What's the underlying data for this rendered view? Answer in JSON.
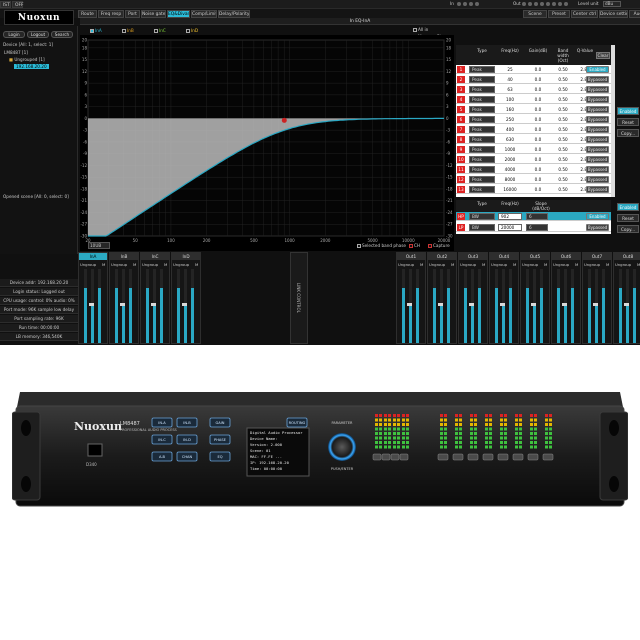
{
  "menu": [
    "IST",
    "OFF"
  ],
  "nav_tabs": [
    {
      "label": "Route",
      "active": false
    },
    {
      "label": "Freq resp",
      "active": false
    },
    {
      "label": "Port",
      "active": false
    },
    {
      "label": "Noise gate",
      "active": false
    },
    {
      "label": "EQ&Divan",
      "active": true
    },
    {
      "label": "Comp/Limit",
      "active": false
    },
    {
      "label": "Delay/Polarity",
      "active": false
    }
  ],
  "right_tabs": [
    "Scene",
    "Preset",
    "Center ctrl",
    "Device setting",
    "Audi"
  ],
  "top_right": {
    "in_label": "In",
    "out_label": "Out",
    "level_label": "Level unit",
    "level_value": "dBu"
  },
  "logo": "Nuoxun",
  "left": {
    "buttons": [
      "Login",
      "Logout",
      "Search"
    ],
    "device_label": "Device [All: 1, select: 1]",
    "tree": [
      "LM8487 [1]",
      "Ungrouped [1]",
      "192.168.20.20"
    ],
    "opened_label": "Opened scene [All: 0, select: 0]",
    "status": [
      "Device addr: 192.168.20.20",
      "Login status: Logged out",
      "CPU usage: control: 0%  audio: 0%",
      "Port mode: 96K sample low delay",
      "Port sampling rate: 96K",
      "Run time: 00:00:00",
      "LB memory: 346,540K"
    ]
  },
  "eq": {
    "header": "In EQ-InA",
    "channels": [
      "InA",
      "InB",
      "InC",
      "InD"
    ],
    "all_in": "All in",
    "mag": "Mag",
    "phase": "Phase",
    "y_ticks": [
      "20",
      "18",
      "15",
      "12",
      "9",
      "6",
      "3",
      "0",
      "-3",
      "-6",
      "-9",
      "-12",
      "-15",
      "-18",
      "-21",
      "-24",
      "-27",
      "-30"
    ],
    "x_ticks": [
      "20",
      "50",
      "100",
      "200",
      "500",
      "1000",
      "2000",
      "5000",
      "10000",
      "20000"
    ],
    "freq_unit": "10UB",
    "bottom": {
      "selected_band": "Selected band phase",
      "ch": "CH",
      "capture": "Capture"
    },
    "table_headers": [
      "Type",
      "Freq(Hz)",
      "Gain(dB)",
      "Band width (Oct)",
      "Q-Value",
      "Clear"
    ],
    "bands": [
      {
        "n": "1",
        "type": "Peak",
        "freq": "25",
        "gain": "0.0",
        "bw": "0.50",
        "q": "2.87",
        "state": "Enabled"
      },
      {
        "n": "2",
        "type": "Peak",
        "freq": "40",
        "gain": "0.0",
        "bw": "0.50",
        "q": "2.87",
        "state": "Bypassed"
      },
      {
        "n": "3",
        "type": "Peak",
        "freq": "63",
        "gain": "0.0",
        "bw": "0.50",
        "q": "2.87",
        "state": "Bypassed"
      },
      {
        "n": "4",
        "type": "Peak",
        "freq": "100",
        "gain": "0.0",
        "bw": "0.50",
        "q": "2.87",
        "state": "Bypassed"
      },
      {
        "n": "5",
        "type": "Peak",
        "freq": "160",
        "gain": "0.0",
        "bw": "0.50",
        "q": "2.87",
        "state": "Bypassed"
      },
      {
        "n": "6",
        "type": "Peak",
        "freq": "250",
        "gain": "0.0",
        "bw": "0.50",
        "q": "2.87",
        "state": "Bypassed"
      },
      {
        "n": "7",
        "type": "Peak",
        "freq": "400",
        "gain": "0.0",
        "bw": "0.50",
        "q": "2.87",
        "state": "Bypassed"
      },
      {
        "n": "8",
        "type": "Peak",
        "freq": "630",
        "gain": "0.0",
        "bw": "0.50",
        "q": "2.87",
        "state": "Bypassed"
      },
      {
        "n": "9",
        "type": "Peak",
        "freq": "1000",
        "gain": "0.0",
        "bw": "0.50",
        "q": "2.87",
        "state": "Bypassed"
      },
      {
        "n": "10",
        "type": "Peak",
        "freq": "2000",
        "gain": "0.0",
        "bw": "0.50",
        "q": "2.87",
        "state": "Bypassed"
      },
      {
        "n": "11",
        "type": "Peak",
        "freq": "4000",
        "gain": "0.0",
        "bw": "0.50",
        "q": "2.87",
        "state": "Bypassed"
      },
      {
        "n": "12",
        "type": "Peak",
        "freq": "8000",
        "gain": "0.0",
        "bw": "0.50",
        "q": "2.87",
        "state": "Bypassed"
      },
      {
        "n": "13",
        "type": "Peak",
        "freq": "16000",
        "gain": "0.0",
        "bw": "0.50",
        "q": "2.87",
        "state": "Bypassed"
      }
    ],
    "side_buttons": [
      "Enabled",
      "Reset",
      "Copy..."
    ],
    "filter_headers": [
      "Type",
      "Freq(Hz)",
      "Slope (dB/Oct)"
    ],
    "filters": [
      {
        "n": "HP",
        "type": "BW",
        "freq": "902",
        "slope": "6",
        "state": "Enabled"
      },
      {
        "n": "LP",
        "type": "BW",
        "freq": "20000",
        "slope": "6",
        "state": "Bypassed"
      }
    ],
    "filter_buttons": [
      "Enabled",
      "Reset",
      "Copy..."
    ],
    "curve": {
      "hp_freq": 902,
      "floor_db": -30,
      "flat_db": 0
    }
  },
  "strips": {
    "inputs": [
      "InA",
      "InB",
      "InC",
      "InD"
    ],
    "outputs": [
      "Out1",
      "Out2",
      "Out3",
      "Out4",
      "Out5",
      "Out6",
      "Out7",
      "Out8"
    ],
    "labels": [
      "Ungroup",
      "M"
    ],
    "center_text": "LINK  CONTROL"
  },
  "device": {
    "brand": "Nuoxun",
    "model": "LM8487",
    "model_sub": "PROFESSIONAL AUDIO PROCESS",
    "usb_label": "D340",
    "buttons_left": [
      "IN-A",
      "IN-B",
      "IN-C",
      "IN-D",
      "A-B",
      "CHAN"
    ],
    "buttons_mid": [
      "GAIN",
      "DELAY",
      "PHASE",
      "MUTE",
      "EQ",
      "SAVE"
    ],
    "buttons_right": [
      "ROUTING",
      "RECALL",
      "SETTING"
    ],
    "lcd_lines": [
      "Digital Audio Processor",
      "Device Name:",
      "Version: 2.000",
      "Scene: 01",
      "MAC: FF.FE ...",
      "IP: 192.168.20.20",
      "Time: 00:00:00"
    ],
    "knob_label": "PUSH/ENTER",
    "knob_top": "PARAMETER"
  },
  "colors": {
    "accent": "#2bbbd8",
    "curve": "#2aa8c4",
    "bg": "#101010",
    "red": "#cc2222"
  }
}
